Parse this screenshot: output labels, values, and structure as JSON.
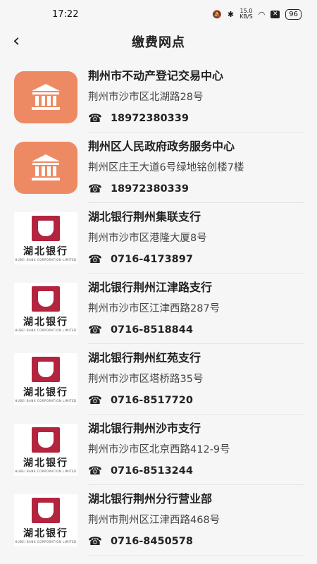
{
  "status": {
    "time": "17:22",
    "speed": "15.0",
    "speed_unit": "KB/S",
    "battery": "96"
  },
  "header": {
    "title": "缴费网点"
  },
  "items": [
    {
      "name": "荆州市不动产登记交易中心",
      "address": "荆州市沙市区北湖路28号",
      "phone": "18972380339",
      "logo": "gov"
    },
    {
      "name": "荆州区人民政府政务服务中心",
      "address": "荆州区庄王大道6号绿地铭创楼7楼",
      "phone": "18972380339",
      "logo": "gov"
    },
    {
      "name": "湖北银行荆州集联支行",
      "address": "荆州市沙市区港隆大厦8号",
      "phone": "0716-4173897",
      "logo": "bank"
    },
    {
      "name": "湖北银行荆州江津路支行",
      "address": "荆州市沙市区江津西路287号",
      "phone": "0716-8518844",
      "logo": "bank"
    },
    {
      "name": "湖北银行荆州红苑支行",
      "address": "荆州市沙市区塔桥路35号",
      "phone": "0716-8517720",
      "logo": "bank"
    },
    {
      "name": "湖北银行荆州沙市支行",
      "address": "荆州市沙市区北京西路412-9号",
      "phone": "0716-8513244",
      "logo": "bank"
    },
    {
      "name": "湖北银行荆州分行营业部",
      "address": "荆州市荆州区江津西路468号",
      "phone": "0716-8450578",
      "logo": "bank"
    }
  ],
  "bank_logo": {
    "name": "湖北银行",
    "sub": "HUBEI BANK CORPORATION LIMITED"
  },
  "icons": {
    "back": "chevron-left-icon",
    "phone": "phone-icon",
    "gov": "government-building-icon"
  },
  "colors": {
    "gov_logo_bg": "#ee8a63",
    "bank_red": "#b3243f"
  }
}
